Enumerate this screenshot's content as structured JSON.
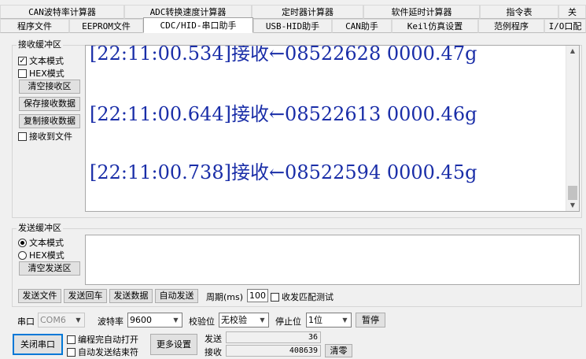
{
  "tabs_row1": [
    "CAN波特率计算器",
    "ADC转换速度计算器",
    "定时器计算器",
    "软件延时计算器",
    "指令表",
    "关"
  ],
  "tabs_row2": [
    "程序文件",
    "EEPROM文件",
    "CDC/HID-串口助手",
    "USB-HID助手",
    "CAN助手",
    "Keil仿真设置",
    "范例程序",
    "I/O口配"
  ],
  "active_tab": "CDC/HID-串口助手",
  "receive": {
    "group_title": "接收缓冲区",
    "text_mode_label": "文本模式",
    "hex_mode_label": "HEX模式",
    "clear_button": "清空接收区",
    "save_button": "保存接收数据",
    "copy_button": "复制接收数据",
    "to_file_label": "接收到文件",
    "lines": [
      "[22:11:00.534]接收←08522628 0000.47g",
      "[22:11:00.644]接收←08522613 0000.46g",
      "[22:11:00.738]接收←08522594 0000.45g"
    ]
  },
  "send": {
    "group_title": "发送缓冲区",
    "text_mode_label": "文本模式",
    "hex_mode_label": "HEX模式",
    "clear_button": "清空发送区",
    "send_file_button": "发送文件",
    "send_enter_button": "发送回车",
    "send_data_button": "发送数据",
    "auto_send_button": "自动发送",
    "period_label": "周期(ms)",
    "period_value": "100",
    "match_label": "收发匹配测试"
  },
  "port": {
    "port_label": "串口",
    "port_value": "COM6",
    "baud_label": "波特率",
    "baud_value": "9600",
    "parity_label": "校验位",
    "parity_value": "无校验",
    "stop_label": "停止位",
    "stop_value": "1位",
    "pause_button": "暂停",
    "close_button": "关闭串口",
    "auto_open_label": "编程完自动打开",
    "auto_end_label": "自动发送结束符",
    "more_button": "更多设置",
    "sent_label": "发送",
    "sent_value": "36",
    "recv_label": "接收",
    "recv_value": "408639",
    "clear_count_button": "清零"
  }
}
